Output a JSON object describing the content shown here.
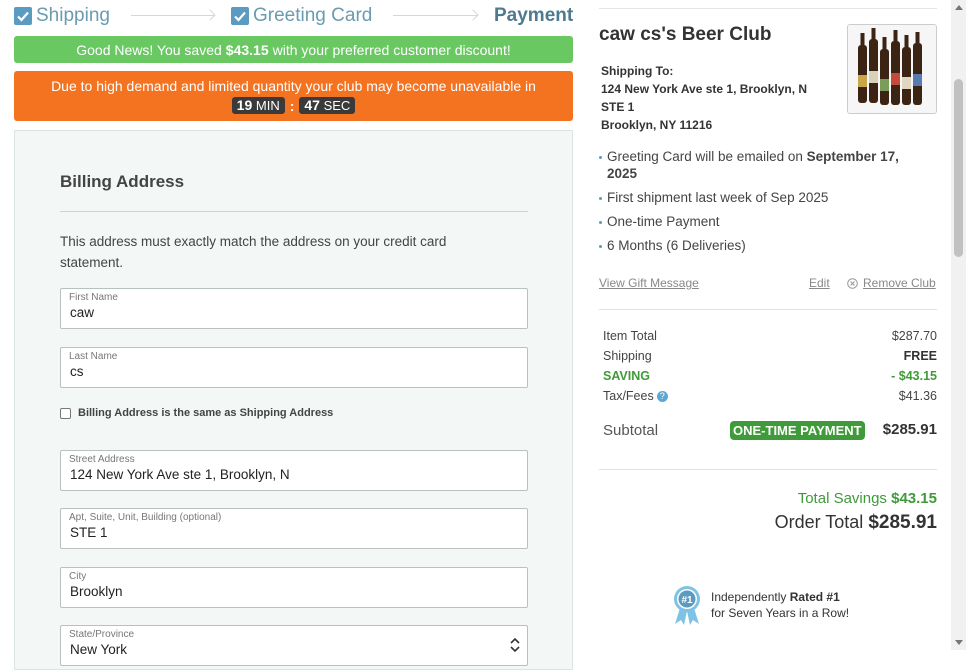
{
  "steps": [
    {
      "label": "Shipping",
      "done": true
    },
    {
      "label": "Greeting Card",
      "done": true
    },
    {
      "label": "Payment",
      "done": false
    }
  ],
  "banner_good": {
    "prefix": "Good News! You saved",
    "amount": "$43.15",
    "suffix": "with your preferred customer discount!"
  },
  "banner_urgency": {
    "text": "Due to high demand and limited quantity your club may become unavailable in",
    "minutes": "19",
    "min_label": "MIN",
    "seconds": "47",
    "sec_label": "SEC"
  },
  "billing": {
    "title": "Billing Address",
    "note": "This address must exactly match the address on your credit card statement.",
    "first_name": {
      "label": "First Name",
      "value": "caw"
    },
    "last_name": {
      "label": "Last Name",
      "value": "cs"
    },
    "same_as_shipping": "Billing Address is the same as Shipping Address",
    "street": {
      "label": "Street Address",
      "value": "124 New York Ave ste 1, Brooklyn, N"
    },
    "apt": {
      "label": "Apt, Suite, Unit, Building (optional)",
      "value": "STE 1"
    },
    "city": {
      "label": "City",
      "value": "Brooklyn"
    },
    "state": {
      "label": "State/Province",
      "value": "New York"
    }
  },
  "summary": {
    "club_title": "caw cs's Beer Club",
    "ship_to_label": "Shipping To:",
    "ship_line1": "124 New York Ave ste 1, Brooklyn, N",
    "ship_line2": "STE 1",
    "ship_line3": "Brooklyn, NY 11216",
    "bullet_card_prefix": "Greeting Card will be emailed on",
    "bullet_card_date": "September 17, 2025",
    "bullet_first_shipment": "First shipment last week of Sep 2025",
    "bullet_payment": "One-time Payment",
    "bullet_duration": "6 Months (6 Deliveries)",
    "view_gift_message": "View Gift Message",
    "edit": "Edit",
    "remove_club": "Remove Club",
    "item_total_label": "Item Total",
    "item_total": "$287.70",
    "shipping_label": "Shipping",
    "shipping": "FREE",
    "saving_label": "SAVING",
    "saving": "- $43.15",
    "tax_label": "Tax/Fees",
    "tax": "$41.36",
    "subtotal_label": "Subtotal",
    "payment_badge": "ONE-TIME PAYMENT",
    "subtotal": "$285.91",
    "total_savings_label": "Total Savings",
    "total_savings": "$43.15",
    "order_total_label": "Order Total",
    "order_total": "$285.91",
    "rated_line1_prefix": "Independently",
    "rated_line1_bold": "Rated #1",
    "rated_line2": "for Seven Years in a Row!"
  },
  "colors": {
    "accent_blue": "#5b9bbf",
    "good_green": "#69c862",
    "urgency_orange": "#f47321",
    "saving_green": "#3f9b39"
  }
}
